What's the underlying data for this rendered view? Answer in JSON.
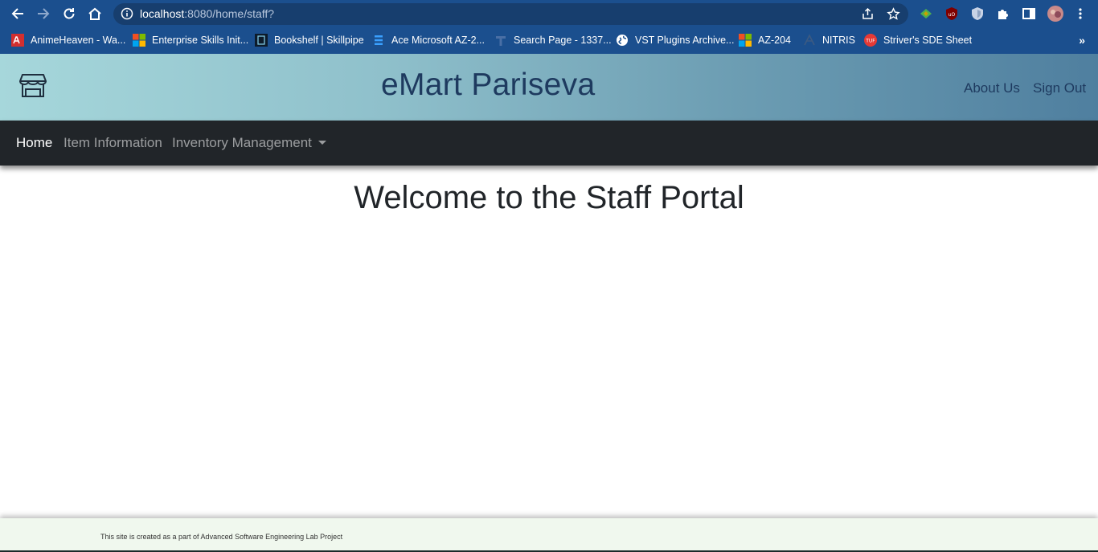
{
  "browser": {
    "url_host": "localhost",
    "url_rest": ":8080/home/staff?",
    "bookmarks": [
      {
        "label": "AnimeHeaven - Wa...",
        "icon": "animeheaven-favicon"
      },
      {
        "label": "Enterprise Skills Init...",
        "icon": "microsoft-favicon"
      },
      {
        "label": "Bookshelf | Skillpipe",
        "icon": "skillpipe-favicon"
      },
      {
        "label": "Ace Microsoft AZ-2...",
        "icon": "ace-favicon"
      },
      {
        "label": "Search Page - 1337...",
        "icon": "search-page-favicon"
      },
      {
        "label": "VST Plugins Archive...",
        "icon": "globe-favicon"
      },
      {
        "label": "AZ-204",
        "icon": "microsoft-favicon"
      },
      {
        "label": "NITRIS",
        "icon": "nitris-favicon"
      },
      {
        "label": "Striver's SDE Sheet",
        "icon": "tuf-favicon"
      }
    ],
    "more_label": "»"
  },
  "header": {
    "title": "eMart Pariseva",
    "about_label": "About Us",
    "signout_label": "Sign Out"
  },
  "nav": {
    "home": "Home",
    "item_information": "Item Information",
    "inventory_management": "Inventory Management"
  },
  "main": {
    "heading": "Welcome to the Staff Portal"
  },
  "footer": {
    "text": "This site is created as a part of Advanced Software Engineering Lab Project"
  },
  "colors": {
    "browser_chrome": "#1b4f8e",
    "navbar": "#212529",
    "title_text": "#1e3a5f",
    "footer_bg": "#f0f8ee"
  }
}
